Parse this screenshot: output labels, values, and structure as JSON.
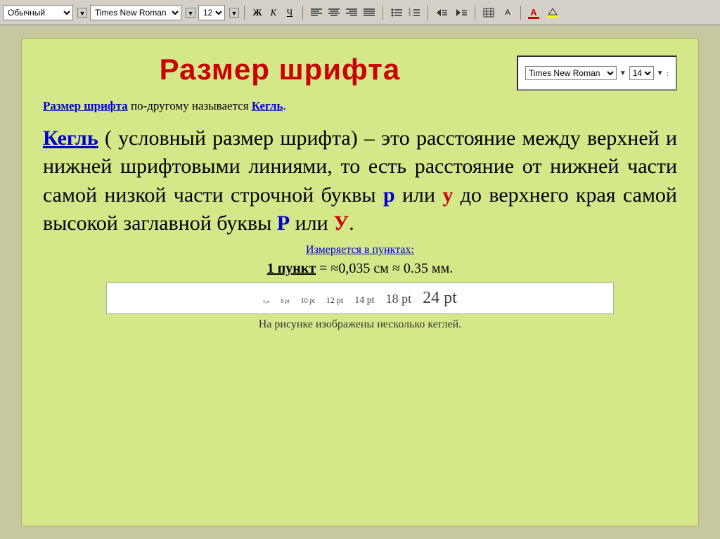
{
  "toolbar": {
    "style_label": "Обычный",
    "font_label": "Times New Roman",
    "size_label": "12",
    "bold_label": "Ж",
    "italic_label": "К",
    "underline_label": "Ч"
  },
  "font_sample": {
    "font_name": "Times New Roman",
    "font_size": "14"
  },
  "slide": {
    "title": "Размер шрифта",
    "subtitle_part1": "Размер шрифта",
    "subtitle_mid": " по-другому называется ",
    "subtitle_link": "Кегль",
    "subtitle_end": ".",
    "main_text_before_term": "",
    "term": "Кегль",
    "main_text_after_term": " ( условный размер шрифта) – это расстояние между верхней и нижней шрифтовыми линиями, то есть расстояние от нижней части самой низкой части строчной буквы ",
    "letter_p": "р",
    "main_text_mid": " или ",
    "letter_y_lower": "у",
    "main_text_to_upper": " до верхнего края самой высокой заглавной буквы ",
    "letter_P": "Р",
    "main_text_or": " или ",
    "letter_Y": "У",
    "main_text_end": ".",
    "measured_text": "Измеряется в пунктах:",
    "point_def_link": "1 пункт",
    "point_def_text": " = ≈0,035 см ≈ 0.35 мм.",
    "size_samples": [
      {
        "size": 6,
        "label": "6 pt"
      },
      {
        "size": 8,
        "label": "8 pt"
      },
      {
        "size": 10,
        "label": "10 pt"
      },
      {
        "size": 12,
        "label": "12 pt"
      },
      {
        "size": 14,
        "label": "14 pt"
      },
      {
        "size": 18,
        "label": "18 pt"
      },
      {
        "size": 24,
        "label": "24 pt"
      }
    ],
    "caption": "На рисунке изображены несколько кеглей."
  }
}
